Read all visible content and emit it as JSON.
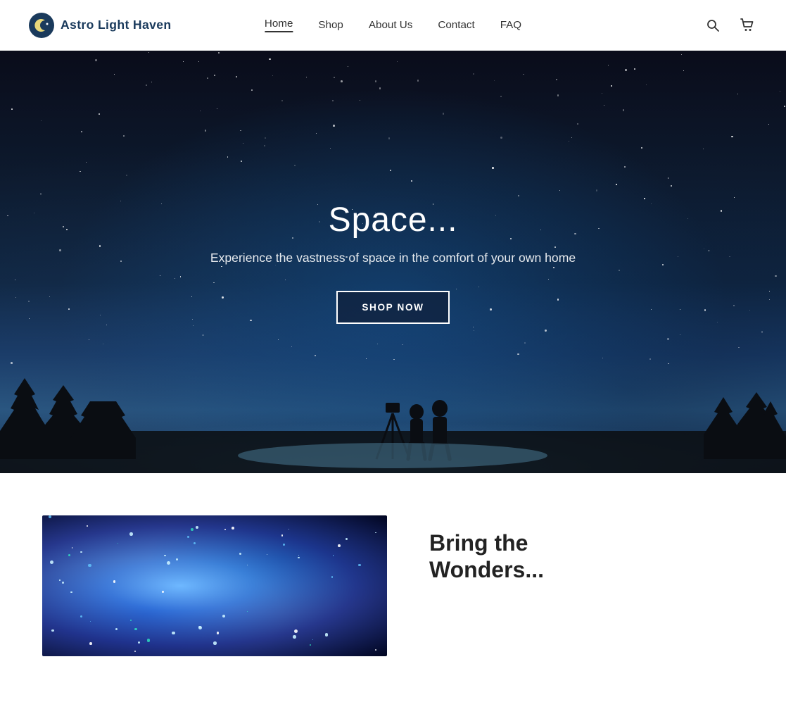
{
  "header": {
    "logo_text": "Astro Light Haven",
    "nav": [
      {
        "label": "Home",
        "active": true
      },
      {
        "label": "Shop",
        "active": false
      },
      {
        "label": "About Us",
        "active": false
      },
      {
        "label": "Contact",
        "active": false
      },
      {
        "label": "FAQ",
        "active": false
      }
    ]
  },
  "hero": {
    "title": "Space...",
    "subtitle": "Experience the vastness of space in the comfort of your own home",
    "cta_label": "SHOP NOW"
  },
  "section": {
    "heading_line1": "Bring the",
    "heading_line2": "Wonders..."
  }
}
